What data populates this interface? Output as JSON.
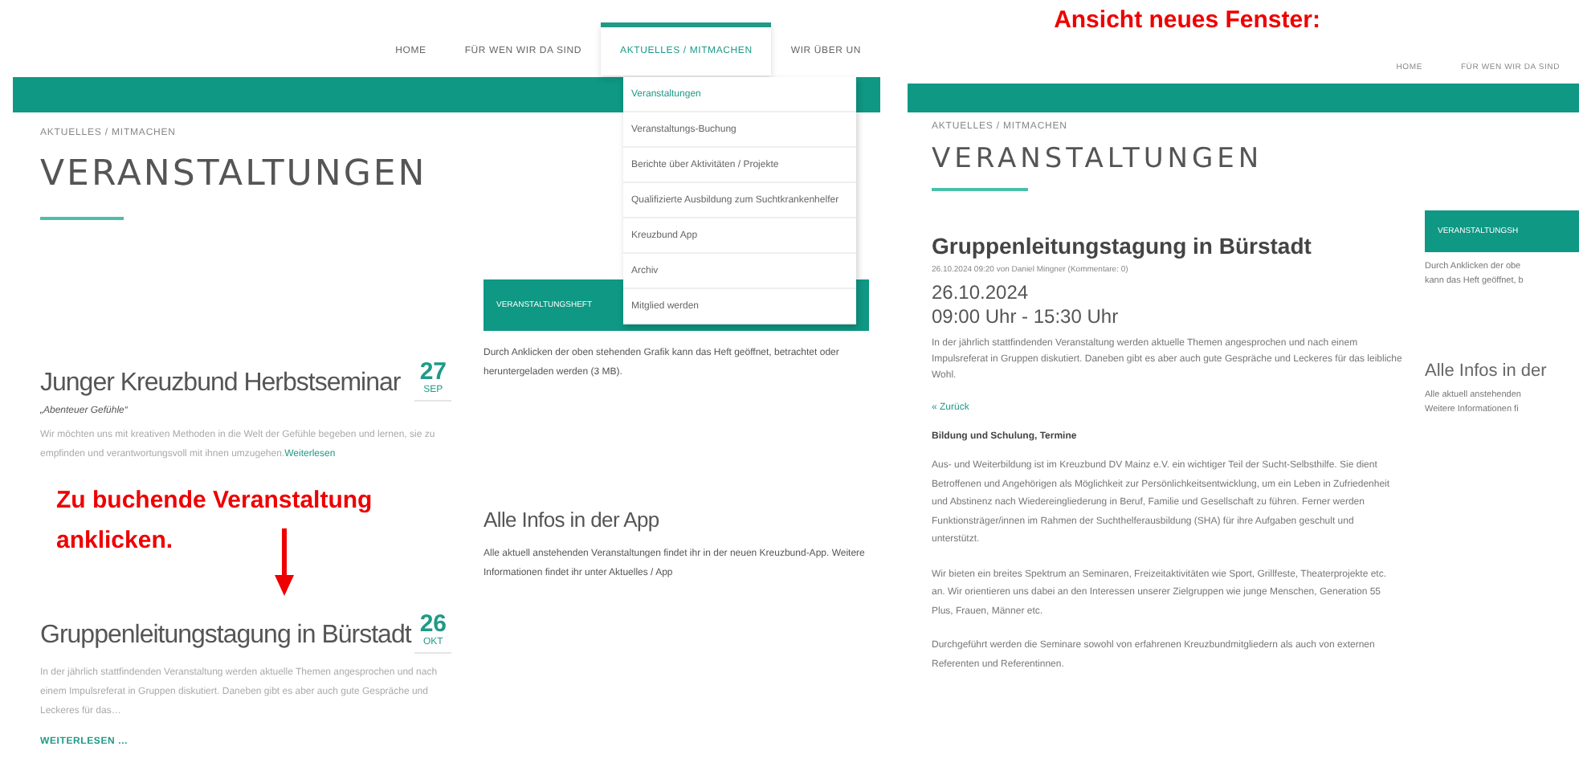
{
  "left_view": {
    "nav": [
      {
        "label": "HOME",
        "selected": false
      },
      {
        "label": "FÜR WEN WIR DA SIND",
        "selected": false
      },
      {
        "label": "AKTUELLES / MITMACHEN",
        "selected": true
      },
      {
        "label": "WIR ÜBER UN",
        "selected": false
      }
    ],
    "dropdown": [
      {
        "label": "Veranstaltungen",
        "selected": true
      },
      {
        "label": "Veranstaltungs-Buchung",
        "selected": false
      },
      {
        "label": "Berichte über Aktivitäten / Projekte",
        "selected": false
      },
      {
        "label": "Qualifizierte Ausbildung zum Suchtkrankenhelfer",
        "selected": false
      },
      {
        "label": "Kreuzbund App",
        "selected": false
      },
      {
        "label": "Archiv",
        "selected": false
      },
      {
        "label": "Mitglied werden",
        "selected": false
      }
    ],
    "breadcrumb": "AKTUELLES / MITMACHEN",
    "title": "VERANSTALTUNGEN",
    "events": [
      {
        "title": "Junger Kreuzbund Herbstseminar",
        "subtitle": "„Abenteuer Gefühle“",
        "day": "27",
        "month": "SEP",
        "excerpt": "Wir möchten uns mit kreativen Methoden in die Welt der Gefühle begeben und lernen, sie zu empfinden und verantwortungsvoll mit ihnen umzugehen.",
        "read_more": {
          "kind": "inline",
          "label": "Weiterlesen"
        }
      },
      {
        "title": "Gruppenleitungstagung in Bürstadt",
        "day": "26",
        "month": "OKT",
        "excerpt": "In der jährlich stattfindenden Veranstaltung werden aktuelle Themen angesprochen und nach einem Impulsreferat in Gruppen diskutiert. Daneben gibt es aber auch gute Gespräche und Leckeres für das…",
        "read_more": {
          "kind": "block",
          "label": "WEITERLESEN ..."
        }
      }
    ],
    "sidebar": {
      "button": "VERANSTALTUNGSHEFT",
      "text": "Durch Anklicken der oben stehenden Grafik kann das Heft geöffnet, betrachtet oder heruntergeladen werden (3 MB).",
      "app_title": "Alle Infos in der App",
      "app_text": "Alle aktuell anstehenden Veranstaltungen findet ihr in der neuen Kreuzbund-App. Weitere Informationen findet ihr unter Aktuelles / App"
    }
  },
  "annotation": {
    "text": "Zu buchende Veranstaltung anklicken."
  },
  "right_view": {
    "caption": "Ansicht neues Fenster:",
    "nav": [
      {
        "label": "HOME",
        "selected": false
      },
      {
        "label": "FÜR WEN WIR DA SIND",
        "selected": false
      }
    ],
    "breadcrumb": "AKTUELLES / MITMACHEN",
    "title": "VERANSTALTUNGEN",
    "article": {
      "title": "Gruppenleitungstagung in Bürstadt",
      "meta": "26.10.2024 09:20 von Daniel Mingner (Kommentare: 0)",
      "date": "26.10.2024",
      "time": "09:00 Uhr - 15:30 Uhr",
      "intro": "In der jährlich stattfindenden Veranstaltung werden aktuelle Themen angesprochen und nach einem Impulsreferat in Gruppen diskutiert. Daneben gibt es aber auch gute Gespräche und Leckeres für das leibliche Wohl.",
      "back": "« Zurück",
      "tags": "Bildung und Schulung, Termine",
      "paragraphs": [
        "Aus- und Weiterbildung ist im Kreuzbund DV Mainz e.V. ein wichtiger Teil der Sucht-Selbsthilfe. Sie dient Betroffenen und Angehörigen als Möglichkeit zur Persönlichkeitsentwicklung, um ein Leben in Zufriedenheit und Abstinenz nach Wiedereingliederung in Beruf, Familie und Gesellschaft zu führen. Ferner werden Funktionsträger/innen im Rahmen der Suchthelferausbildung (SHA) für ihre Aufgaben geschult und unterstützt.",
        "Wir bieten ein breites Spektrum an Seminaren, Freizeitaktivitäten wie Sport, Grillfeste, Theaterprojekte etc. an. Wir orientieren uns dabei an den Interessen unserer Zielgruppen wie junge Menschen, Generation 55 Plus, Frauen, Männer etc.",
        "Durchgeführt werden die Seminare sowohl von erfahrenen Kreuzbundmitgliedern als auch von externen Referenten und Referentinnen."
      ]
    },
    "sidebar": {
      "button": "VERANSTALTUNGSH",
      "text_lines": [
        "Durch Anklicken der obe",
        "kann das Heft geöffnet, b"
      ],
      "app_title": "Alle Infos in der",
      "app_lines": [
        "Alle aktuell anstehenden",
        "Weitere Informationen fi"
      ]
    }
  }
}
